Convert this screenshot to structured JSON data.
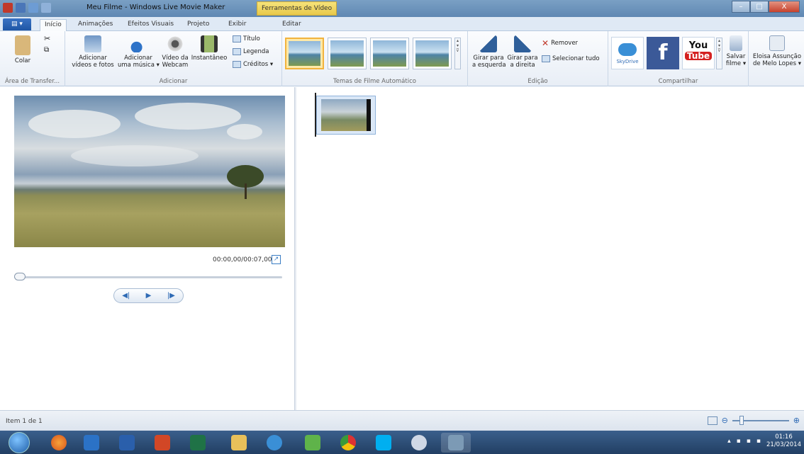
{
  "window": {
    "title": "Meu Filme - Windows Live Movie Maker",
    "contextual_tab": "Ferramentas de Vídeo",
    "controls": {
      "minimize": "–",
      "maximize": "□",
      "close": "X"
    }
  },
  "tabs": {
    "file": "▤ ▾",
    "inicio": "Início",
    "animacoes": "Animações",
    "efeitos": "Efeitos Visuais",
    "projeto": "Projeto",
    "exibir": "Exibir",
    "editar": "Editar"
  },
  "ribbon": {
    "clipboard": {
      "paste": "Colar",
      "group": "Área de Transfer..."
    },
    "adicionar": {
      "add_videos_line1": "Adicionar",
      "add_videos_line2": "vídeos e fotos",
      "add_music_line1": "Adicionar",
      "add_music_line2": "uma música ▾",
      "webcam_line1": "Vídeo da",
      "webcam_line2": "Webcam",
      "snapshot": "Instantâneo",
      "title": "Título",
      "caption": "Legenda",
      "credits": "Créditos ▾",
      "group": "Adicionar"
    },
    "temas": {
      "group": "Temas de Filme Automático"
    },
    "edicao": {
      "rotate_left_line1": "Girar para",
      "rotate_left_line2": "a esquerda",
      "rotate_right_line1": "Girar para",
      "rotate_right_line2": "a direita",
      "remove": "Remover",
      "select_all": "Selecionar tudo",
      "group": "Edição"
    },
    "compartilhar": {
      "skydrive": "SkyDrive",
      "facebook": "f",
      "youtube_top": "You",
      "youtube_bottom": "Tube",
      "save_line1": "Salvar",
      "save_line2": "filme ▾",
      "group": "Compartilhar"
    },
    "user": {
      "line1": "Eloisa Assunção",
      "line2": "de Melo Lopes ▾"
    }
  },
  "preview": {
    "time": "00:00,00/00:07,00",
    "controls": {
      "prev": "◀|",
      "play": "▶",
      "next": "|▶"
    }
  },
  "status": {
    "text": "Item 1 de 1",
    "zoom_out": "⊖",
    "zoom_in": "⊕"
  },
  "taskbar": {
    "time": "01:16",
    "date": "21/03/2014"
  },
  "colors": {
    "accent": "#2f6bb5",
    "selected_theme": "#f2b33d",
    "taskbar": "#2a4a73"
  }
}
